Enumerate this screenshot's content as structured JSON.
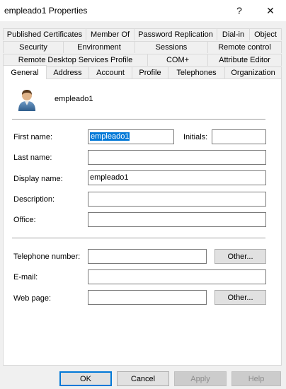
{
  "window": {
    "title": "empleado1 Properties",
    "help_icon": "?",
    "close_icon": "✕"
  },
  "tabs": {
    "row1": [
      "Published Certificates",
      "Member Of",
      "Password Replication",
      "Dial-in",
      "Object"
    ],
    "row2": [
      "Security",
      "Environment",
      "Sessions",
      "Remote control"
    ],
    "row3": [
      "Remote Desktop Services Profile",
      "COM+",
      "Attribute Editor"
    ],
    "row4": [
      "General",
      "Address",
      "Account",
      "Profile",
      "Telephones",
      "Organization"
    ],
    "active": "General"
  },
  "general": {
    "user_display": "empleado1",
    "first_name_label": "First name:",
    "first_name_value": "empleado1",
    "initials_label": "Initials:",
    "initials_value": "",
    "last_name_label": "Last name:",
    "last_name_value": "",
    "display_name_label": "Display name:",
    "display_name_value": "empleado1",
    "description_label": "Description:",
    "description_value": "",
    "office_label": "Office:",
    "office_value": "",
    "telephone_label": "Telephone number:",
    "telephone_value": "",
    "telephone_other": "Other...",
    "email_label": "E-mail:",
    "email_value": "",
    "webpage_label": "Web page:",
    "webpage_value": "",
    "webpage_other": "Other..."
  },
  "buttons": {
    "ok": "OK",
    "cancel": "Cancel",
    "apply": "Apply",
    "help": "Help"
  },
  "icons": {
    "avatar": "user-icon"
  }
}
